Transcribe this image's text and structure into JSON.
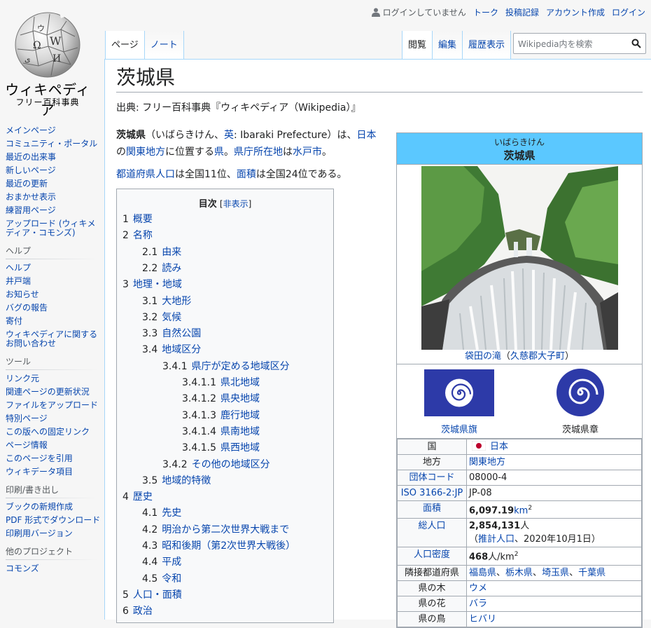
{
  "logo": {
    "wordmark": "ウィキペディア",
    "tagline": "フリー百科事典"
  },
  "personal": {
    "user_status": "ログインしていません",
    "links": [
      "トーク",
      "投稿記録",
      "アカウント作成",
      "ログイン"
    ]
  },
  "tabs_left": [
    "ページ",
    "ノート"
  ],
  "tabs_right": [
    "閲覧",
    "編集",
    "履歴表示"
  ],
  "search": {
    "placeholder": "Wikipedia内を検索"
  },
  "sidebar": {
    "nav": [
      "メインページ",
      "コミュニティ・ポータル",
      "最近の出来事",
      "新しいページ",
      "最近の更新",
      "おまかせ表示",
      "練習用ページ",
      "アップロード (ウィキメディア・コモンズ)"
    ],
    "help_title": "ヘルプ",
    "help": [
      "ヘルプ",
      "井戸端",
      "お知らせ",
      "バグの報告",
      "寄付",
      "ウィキペディアに関するお問い合わせ"
    ],
    "tools_title": "ツール",
    "tools": [
      "リンク元",
      "関連ページの更新状況",
      "ファイルをアップロード",
      "特別ページ",
      "この版への固定リンク",
      "ページ情報",
      "このページを引用",
      "ウィキデータ項目"
    ],
    "print_title": "印刷/書き出し",
    "print": [
      "ブックの新規作成",
      "PDF 形式でダウンロード",
      "印刷用バージョン"
    ],
    "projects_title": "他のプロジェクト",
    "projects": [
      "コモンズ"
    ]
  },
  "article": {
    "title": "茨城県",
    "site_sub": "出典: フリー百科事典『ウィキペディア（Wikipedia）』",
    "lead": {
      "bold": "茨城県",
      "p1": "（いばらきけん、",
      "eng_link": "英",
      "p2": ": Ibaraki Prefecture）は、",
      "link_japan": "日本",
      "p3": "の",
      "link_kanto": "関東地方",
      "p4": "に位置する",
      "link_pref": "県",
      "p5": "。",
      "link_seat": "県庁所在地",
      "p6": "は",
      "link_mito": "水戸市",
      "p7": "。"
    },
    "lead2": {
      "link_pop": "都道府県人口",
      "p1": "は全国11位、",
      "link_area": "面積",
      "p2": "は全国24位である。"
    }
  },
  "toc": {
    "title": "目次",
    "toggle": "非表示",
    "items": [
      {
        "num": "1",
        "label": "概要",
        "level": 1
      },
      {
        "num": "2",
        "label": "名称",
        "level": 1
      },
      {
        "num": "2.1",
        "label": "由来",
        "level": 2
      },
      {
        "num": "2.2",
        "label": "読み",
        "level": 2
      },
      {
        "num": "3",
        "label": "地理・地域",
        "level": 1
      },
      {
        "num": "3.1",
        "label": "大地形",
        "level": 2
      },
      {
        "num": "3.2",
        "label": "気候",
        "level": 2
      },
      {
        "num": "3.3",
        "label": "自然公園",
        "level": 2
      },
      {
        "num": "3.4",
        "label": "地域区分",
        "level": 2
      },
      {
        "num": "3.4.1",
        "label": "県庁が定める地域区分",
        "level": 3
      },
      {
        "num": "3.4.1.1",
        "label": "県北地域",
        "level": 4
      },
      {
        "num": "3.4.1.2",
        "label": "県央地域",
        "level": 4
      },
      {
        "num": "3.4.1.3",
        "label": "鹿行地域",
        "level": 4
      },
      {
        "num": "3.4.1.4",
        "label": "県南地域",
        "level": 4
      },
      {
        "num": "3.4.1.5",
        "label": "県西地域",
        "level": 4
      },
      {
        "num": "3.4.2",
        "label": "その他の地域区分",
        "level": 3
      },
      {
        "num": "3.5",
        "label": "地域的特徴",
        "level": 2
      },
      {
        "num": "4",
        "label": "歴史",
        "level": 1
      },
      {
        "num": "4.1",
        "label": "先史",
        "level": 2
      },
      {
        "num": "4.2",
        "label": "明治から第二次世界大戦まで",
        "level": 2
      },
      {
        "num": "4.3",
        "label": "昭和後期（第2次世界大戦後）",
        "level": 2
      },
      {
        "num": "4.4",
        "label": "平成",
        "level": 2
      },
      {
        "num": "4.5",
        "label": "令和",
        "level": 2
      },
      {
        "num": "5",
        "label": "人口・面積",
        "level": 1
      },
      {
        "num": "6",
        "label": "政治",
        "level": 1
      }
    ]
  },
  "infobox": {
    "reading": "いばらきけん",
    "name": "茨城県",
    "photo_caption_link1": "袋田の滝",
    "photo_caption_mid": "（",
    "photo_caption_link2": "久慈郡大子町",
    "photo_caption_end": "）",
    "flag_label": "茨城県旗",
    "emblem_label": "茨城県章",
    "rows": [
      {
        "key": "国",
        "value": "日本",
        "key_link": false,
        "value_link": true,
        "flag": true
      },
      {
        "key": "地方",
        "value": "関東地方",
        "key_link": false,
        "value_link": true
      },
      {
        "key": "団体コード",
        "value": "08000-4",
        "key_link": true,
        "value_link": false
      },
      {
        "key": "ISO 3166-2:JP",
        "value": "JP-08",
        "key_link": true,
        "value_link": false
      },
      {
        "key": "面積",
        "value": "6,097.19",
        "unit": "km",
        "unit_sup": "2",
        "key_link": true,
        "bold": true
      },
      {
        "key": "総人口",
        "value": "2,854,131",
        "unit": "人",
        "sub_link": "推計人口",
        "sub_text": "、2020年10月1日）",
        "sub_open": "（",
        "key_link": true,
        "bold": true
      },
      {
        "key": "人口密度",
        "value": "468",
        "unit": "人/km",
        "unit_sup": "2",
        "key_link": true,
        "bold": true
      },
      {
        "key": "隣接都道府県",
        "values": [
          "福島県",
          "栃木県",
          "埼玉県",
          "千葉県"
        ],
        "key_link": false
      },
      {
        "key": "県の木",
        "value": "ウメ",
        "key_link": false,
        "value_link": true
      },
      {
        "key": "県の花",
        "value": "バラ",
        "key_link": false,
        "value_link": true
      },
      {
        "key": "県の鳥",
        "value": "ヒバリ",
        "key_link": false,
        "value_link": true
      }
    ]
  },
  "colors": {
    "link": "#0645ad",
    "infobox_header": "#5bc8ff",
    "tab_border": "#a7d7f9",
    "flag_blue": "#2d3aa8"
  }
}
